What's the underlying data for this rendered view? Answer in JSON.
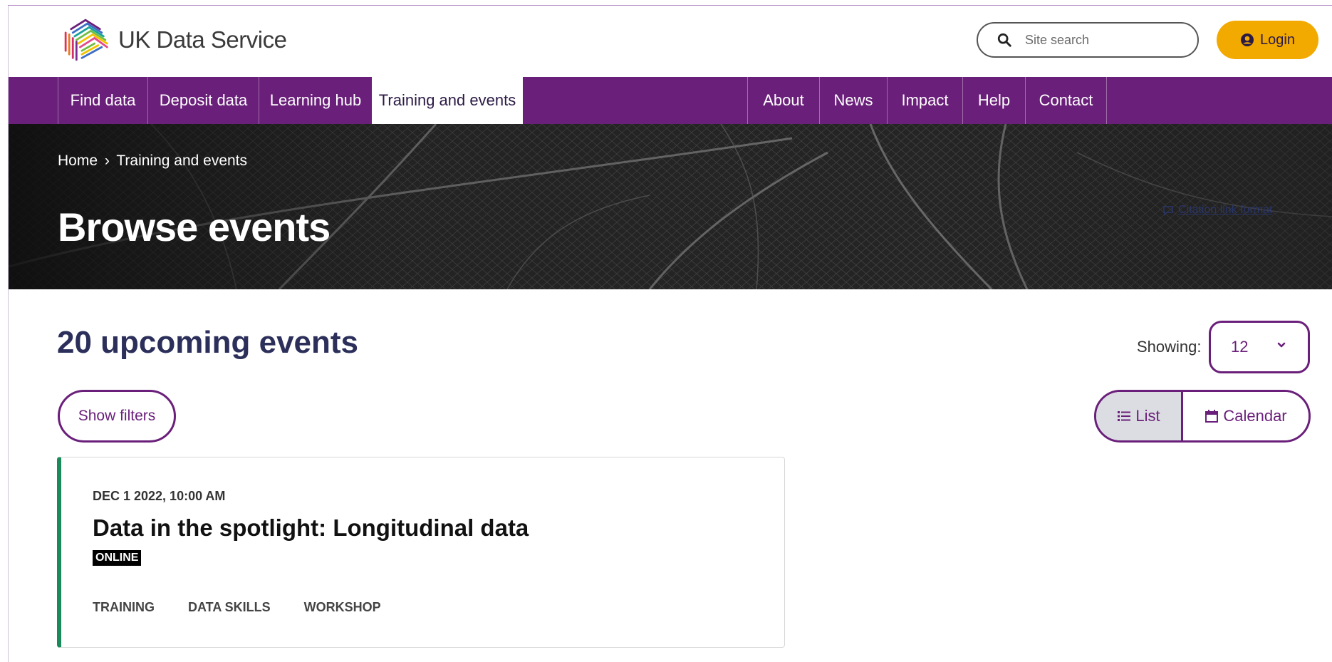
{
  "brand": {
    "name": "UK Data Service"
  },
  "header": {
    "search_placeholder": "Site search",
    "login_label": "Login",
    "colors": {
      "accent": "#f2a900",
      "nav": "#6a1f7a"
    }
  },
  "nav": {
    "primary": [
      {
        "label": "Find data"
      },
      {
        "label": "Deposit data"
      },
      {
        "label": "Learning hub"
      },
      {
        "label": "Training and events",
        "active": true
      }
    ],
    "secondary": [
      {
        "label": "About"
      },
      {
        "label": "News"
      },
      {
        "label": "Impact"
      },
      {
        "label": "Help"
      },
      {
        "label": "Contact"
      }
    ]
  },
  "hero": {
    "breadcrumb": {
      "home": "Home",
      "separator": "›",
      "current": "Training and events"
    },
    "title": "Browse events",
    "credit": "Citation link format"
  },
  "results": {
    "count_label": "20 upcoming events",
    "showing_label": "Showing:",
    "showing_value": "12",
    "show_filters_label": "Show filters",
    "view_list_label": "List",
    "view_calendar_label": "Calendar"
  },
  "events": [
    {
      "datetime": "DEC 1 2022, 10:00 AM",
      "title": "Data in the spotlight: Longitudinal data",
      "badge": "ONLINE",
      "tags": [
        "TRAINING",
        "DATA SKILLS",
        "WORKSHOP"
      ],
      "accent_color": "#1a8a5a"
    }
  ]
}
